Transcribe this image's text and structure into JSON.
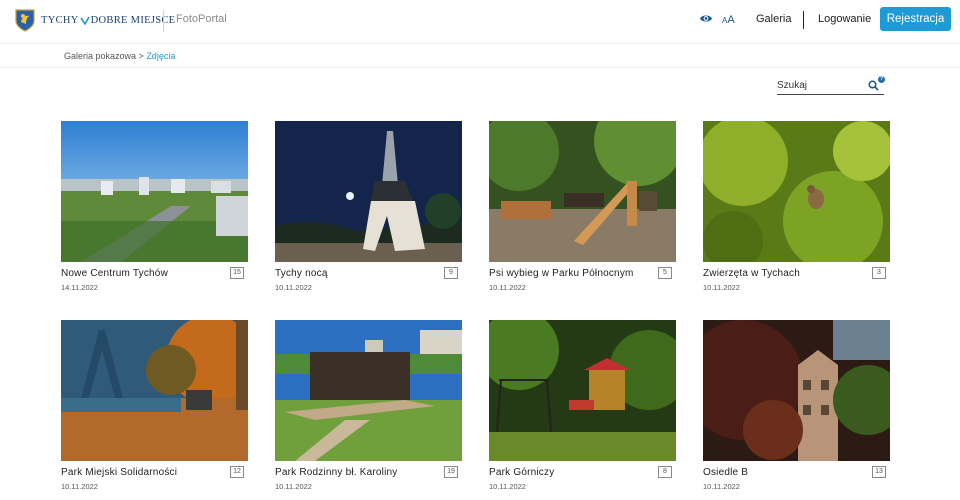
{
  "header": {
    "logo_left": "TYCHY",
    "logo_right": "DOBRE MIEJSCE",
    "portal_name": "FotoPortal",
    "font_size_small": "A",
    "font_size_large": "A",
    "nav_gallery": "Galeria",
    "nav_login": "Logowanie",
    "register_label": "Rejestracja",
    "accent_color": "#1e9ad6"
  },
  "breadcrumb": {
    "parent": "Galeria pokazowa",
    "separator": " > ",
    "current": "Zdjęcia"
  },
  "search": {
    "placeholder": "Szukaj",
    "help_badge": "?"
  },
  "icons": [
    "crest-icon",
    "heart-icon",
    "eye-icon",
    "search-icon",
    "help-icon"
  ],
  "gallery": [
    {
      "title": "Nowe Centrum Tychów",
      "date": "14.11.2022",
      "count": "15"
    },
    {
      "title": "Tychy nocą",
      "date": "10.11.2022",
      "count": "9"
    },
    {
      "title": "Psi wybieg w Parku Północnym",
      "date": "10.11.2022",
      "count": "5"
    },
    {
      "title": "Zwierzęta w Tychach",
      "date": "10.11.2022",
      "count": "3"
    },
    {
      "title": "Park Miejski Solidarności",
      "date": "10.11.2022",
      "count": "12"
    },
    {
      "title": "Park Rodzinny bł. Karoliny",
      "date": "10.11.2022",
      "count": "19"
    },
    {
      "title": "Park Górniczy",
      "date": "10.11.2022",
      "count": "8"
    },
    {
      "title": "Osiedle B",
      "date": "10.11.2022",
      "count": "13"
    }
  ]
}
